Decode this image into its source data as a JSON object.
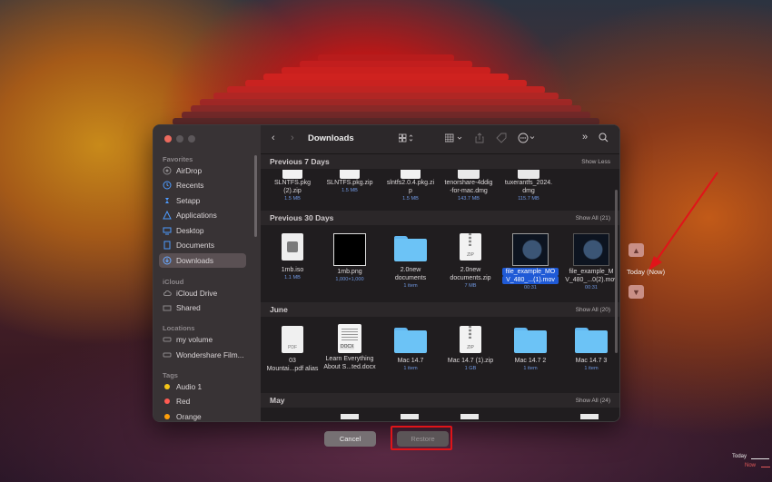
{
  "window": {
    "title": "Downloads"
  },
  "sidebar": {
    "favorites_label": "Favorites",
    "favorites": [
      {
        "label": "AirDrop",
        "icon": "airdrop-icon"
      },
      {
        "label": "Recents",
        "icon": "clock-icon"
      },
      {
        "label": "Setapp",
        "icon": "setapp-icon"
      },
      {
        "label": "Applications",
        "icon": "applications-icon"
      },
      {
        "label": "Desktop",
        "icon": "desktop-icon"
      },
      {
        "label": "Documents",
        "icon": "document-icon"
      },
      {
        "label": "Downloads",
        "icon": "download-icon",
        "active": true
      }
    ],
    "icloud_label": "iCloud",
    "icloud": [
      {
        "label": "iCloud Drive",
        "icon": "cloud-icon"
      },
      {
        "label": "Shared",
        "icon": "shared-folder-icon"
      }
    ],
    "locations_label": "Locations",
    "locations": [
      {
        "label": "my volume",
        "icon": "drive-icon"
      },
      {
        "label": "Wondershare Film...",
        "icon": "drive-icon"
      }
    ],
    "tags_label": "Tags",
    "tags": [
      {
        "label": "Audio 1",
        "color": "#f5c518"
      },
      {
        "label": "Red",
        "color": "#ff5b52"
      },
      {
        "label": "Orange",
        "color": "#ff9f0a"
      }
    ]
  },
  "groups": {
    "prev7": {
      "title": "Previous 7 Days",
      "action": "Show Less",
      "files": [
        {
          "name1": "SLNTFS.pkg",
          "name2": "(2).zip",
          "meta": "1.5 MB"
        },
        {
          "name1": "SLNTFS.pkg.zip",
          "name2": "",
          "meta": "1.5 MB"
        },
        {
          "name1": "slntfs2.0.4.pkg.zi",
          "name2": "p",
          "meta": "1.5 MB"
        },
        {
          "name1": "tenorshare-4ddig",
          "name2": "-for-mac.dmg",
          "meta": "143.7 MB"
        },
        {
          "name1": "tuxerantfs_2024.",
          "name2": "dmg",
          "meta": "115.7 MB"
        }
      ]
    },
    "prev30": {
      "title": "Previous 30 Days",
      "action": "Show All (21)",
      "files": [
        {
          "name1": "1mb.iso",
          "name2": "",
          "meta": "1.1 MB"
        },
        {
          "name1": "1mb.png",
          "name2": "",
          "meta": "1,000×1,000"
        },
        {
          "name1": "2.0new",
          "name2": "documents",
          "meta": "1 item"
        },
        {
          "name1": "2.0new",
          "name2": "documents.zip",
          "meta": "7 MB",
          "zip_label": "ZIP"
        },
        {
          "name1": "file_example_MO",
          "name2": "V_480_...(1).mov",
          "meta": "00:31"
        },
        {
          "name1": "file_example_M",
          "name2": "V_480_...0(2).mov",
          "meta": "00:31"
        }
      ]
    },
    "june": {
      "title": "June",
      "action": "Show All (20)",
      "files": [
        {
          "name1": "03",
          "name2": "Mountai...pdf alias",
          "meta": "",
          "pdf_label": "PDF"
        },
        {
          "name1": "Learn Everything",
          "name2": "About S...ted.docx",
          "meta": "",
          "docx_label": "DOCX"
        },
        {
          "name1": "Mac 14.7",
          "name2": "",
          "meta": "1 item"
        },
        {
          "name1": "Mac 14.7 (1).zip",
          "name2": "",
          "meta": "1 GB",
          "zip_label": "ZIP"
        },
        {
          "name1": "Mac 14.7 2",
          "name2": "",
          "meta": "1 item"
        },
        {
          "name1": "Mac 14.7 3",
          "name2": "",
          "meta": "1 item"
        }
      ]
    },
    "may": {
      "title": "May",
      "action": "Show All (24)"
    }
  },
  "buttons": {
    "cancel": "Cancel",
    "restore": "Restore"
  },
  "timemachine": {
    "current_label": "Today (Now)",
    "timeline_today": "Today",
    "timeline_now": "Now"
  },
  "colors": {
    "selection": "#1f5ad6",
    "highlight": "#e01419",
    "folder": "#6cc3f6"
  }
}
